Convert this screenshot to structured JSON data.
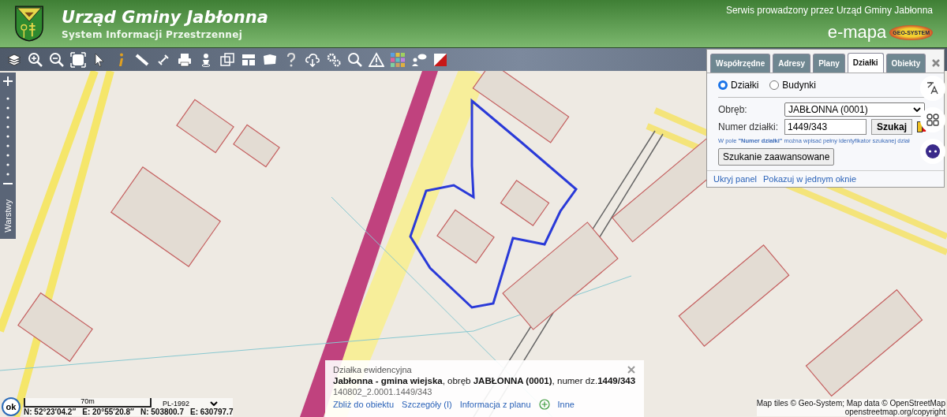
{
  "header": {
    "title": "Urząd Gminy Jabłonna",
    "subtitle": "System Informacji Przestrzennej",
    "operator": "Serwis prowadzony przez Urząd Gminy Jabłonna",
    "brand": "e-mapa",
    "brand_logo": "GEO-SYSTEM"
  },
  "side_bar": {
    "layers_tab": "Warstwy"
  },
  "panel": {
    "tabs": [
      {
        "label": "Współrzędne",
        "selected": false
      },
      {
        "label": "Adresy",
        "selected": false
      },
      {
        "label": "Plany",
        "selected": false
      },
      {
        "label": "Działki",
        "selected": true
      },
      {
        "label": "Obiekty",
        "selected": false
      }
    ],
    "modes": [
      {
        "label": "Działki",
        "selected": true
      },
      {
        "label": "Budynki",
        "selected": false
      }
    ],
    "precinct_label": "Obręb:",
    "precinct_value": "JABŁONNA (0001)",
    "parcel_label": "Numer działki:",
    "parcel_value": "1449/343",
    "search_button": "Szukaj",
    "hint": "W pole **\"Numer działki\"** można wpisać pełny identyfikator szukanej dział",
    "advanced_button": "Szukanie zaawansowane",
    "links": [
      "Ukryj panel",
      "Pokazuj w jednym oknie"
    ]
  },
  "popup": {
    "title": "Działka ewidencyjna",
    "description": "**Jabłonna - gmina wiejska**, obręb **JABŁONNA (0001)**, numer dz.**1449/343**",
    "identifier": "140802_2.0001.1449/343",
    "links": [
      "Zbliż do obiektu",
      "Szczegóły (I)",
      "Informacja z planu"
    ],
    "more": "Inne"
  },
  "status": {
    "ok_button": "ok",
    "scale": "70m",
    "crs": "PL-1992",
    "coordinates": [
      "N: 52°23′04.2″",
      "E: 20°55′20.8″",
      "N: 503800.7",
      "E: 630797.7"
    ]
  },
  "attribution": {
    "tiles": "Map tiles © Geo-System; Map data © OpenStreetMap",
    "copyright": "openstreetmap.org/copyright"
  }
}
